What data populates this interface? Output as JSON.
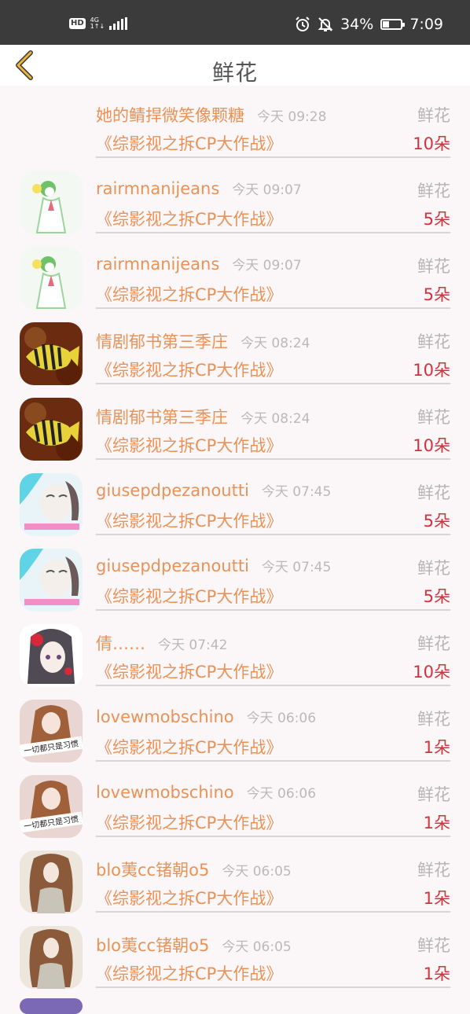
{
  "status_bar": {
    "hd": "HD",
    "network": "4G",
    "network_sub": "1↑↓",
    "battery": "34%",
    "battery_level": 0.34,
    "time": "7:09",
    "icons": [
      "alarm-icon",
      "mute-icon",
      "battery-icon",
      "signal-icon"
    ]
  },
  "header": {
    "title": "鲜花",
    "back_icon": "chevron-left-icon",
    "accent": "#e8b63a"
  },
  "colors": {
    "name": "#e99257",
    "count": "#d2313d",
    "muted": "#b9b9b9"
  },
  "rows": [
    {
      "name": "她的鲭捍微笑像颗糖",
      "time": "今天 09:28",
      "type": "鲜花",
      "work": "《综影视之拆CP大作战》",
      "count": "10朵",
      "avatar": "none"
    },
    {
      "name": "rairmnanijeans",
      "time": "今天 09:07",
      "type": "鲜花",
      "work": "《综影视之拆CP大作战》",
      "count": "5朵",
      "avatar": "gardevoir"
    },
    {
      "name": "rairmnanijeans",
      "time": "今天 09:07",
      "type": "鲜花",
      "work": "《综影视之拆CP大作战》",
      "count": "5朵",
      "avatar": "gardevoir"
    },
    {
      "name": "情剧郁书第三季庄",
      "time": "今天 08:24",
      "type": "鲜花",
      "work": "《综影视之拆CP大作战》",
      "count": "10朵",
      "avatar": "fish"
    },
    {
      "name": "情剧郁书第三季庄",
      "time": "今天 08:24",
      "type": "鲜花",
      "work": "《综影视之拆CP大作战》",
      "count": "10朵",
      "avatar": "fish"
    },
    {
      "name": "giusepdpezanoutti",
      "time": "今天 07:45",
      "type": "鲜花",
      "work": "《综影视之拆CP大作战》",
      "count": "5朵",
      "avatar": "face"
    },
    {
      "name": "giusepdpezanoutti",
      "time": "今天 07:45",
      "type": "鲜花",
      "work": "《综影视之拆CP大作战》",
      "count": "5朵",
      "avatar": "face"
    },
    {
      "name": "倩……",
      "time": "今天 07:42",
      "type": "鲜花",
      "work": "《综影视之拆CP大作战》",
      "count": "10朵",
      "avatar": "anime"
    },
    {
      "name": "lovewmobschino",
      "time": "今天 06:06",
      "type": "鲜花",
      "work": "《综影视之拆CP大作战》",
      "count": "1朵",
      "avatar": "girl",
      "avatar_text": "一切都只是习惯"
    },
    {
      "name": "lovewmobschino",
      "time": "今天 06:06",
      "type": "鲜花",
      "work": "《综影视之拆CP大作战》",
      "count": "1朵",
      "avatar": "girl",
      "avatar_text": "一切都只是习惯"
    },
    {
      "name": "blo荑cc锗朝o5",
      "time": "今天 06:05",
      "type": "鲜花",
      "work": "《综影视之拆CP大作战》",
      "count": "1朵",
      "avatar": "hair"
    },
    {
      "name": "blo荑cc锗朝o5",
      "time": "今天 06:05",
      "type": "鲜花",
      "work": "《综影视之拆CP大作战》",
      "count": "1朵",
      "avatar": "hair"
    }
  ]
}
